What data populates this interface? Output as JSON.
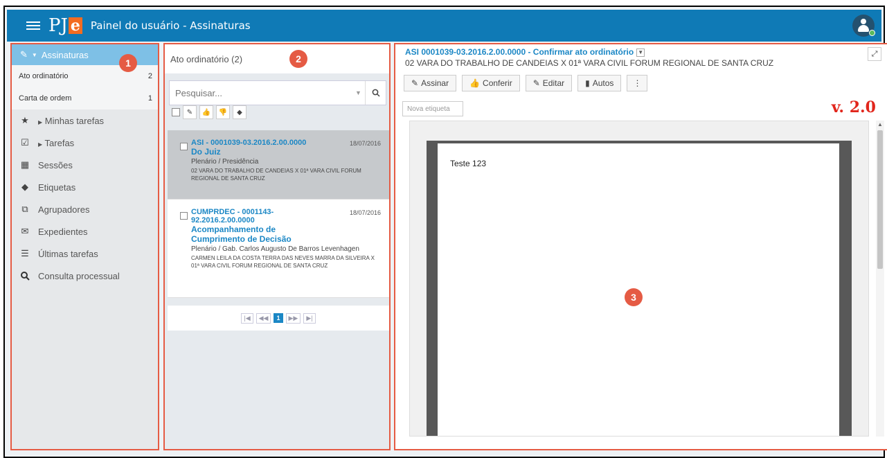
{
  "header": {
    "logo_main": "PJ",
    "logo_accent": "e",
    "title": "Painel do usuário - Assinaturas"
  },
  "sidebar": {
    "section_title": "Assinaturas",
    "sub_items": [
      {
        "label": "Ato ordinatório",
        "count": "2"
      },
      {
        "label": "Carta de ordem",
        "count": "1"
      }
    ],
    "items": [
      {
        "label": "Minhas tarefas"
      },
      {
        "label": "Tarefas"
      },
      {
        "label": "Sessões"
      },
      {
        "label": "Etiquetas"
      },
      {
        "label": "Agrupadores"
      },
      {
        "label": "Expedientes"
      },
      {
        "label": "Últimas tarefas"
      },
      {
        "label": "Consulta processual"
      }
    ]
  },
  "middle": {
    "heading": "Ato ordinatório (2)",
    "search_placeholder": "Pesquisar...",
    "cards": [
      {
        "number": "ASI - 0001039-03.2016.2.00.0000",
        "kind": "Do Juiz",
        "date": "18/07/2016",
        "org": "Plenário / Presidência",
        "parts": "02 VARA DO TRABALHO DE CANDEIAS X 01ª VARA CIVIL FORUM REGIONAL DE SANTA CRUZ"
      },
      {
        "number": "CUMPRDEC - 0001143-92.2016.2.00.0000",
        "kind": "Acompanhamento de Cumprimento de Decisão",
        "date": "18/07/2016",
        "org": "Plenário / Gab. Carlos Augusto De Barros Levenhagen",
        "parts": "CARMEN LEILA DA COSTA TERRA DAS NEVES MARRA DA SILVEIRA X 01ª VARA CIVIL FORUM REGIONAL DE SANTA CRUZ"
      }
    ],
    "pager": {
      "current": "1"
    }
  },
  "detail": {
    "doc_title": "ASI 0001039-03.2016.2.00.0000 - Confirmar ato ordinatório",
    "doc_parts": "02 VARA DO TRABALHO DE CANDEIAS X 01ª VARA CIVIL FORUM REGIONAL DE SANTA CRUZ",
    "actions": {
      "sign": "Assinar",
      "check": "Conferir",
      "edit": "Editar",
      "records": "Autos"
    },
    "tag_placeholder": "Nova etiqueta",
    "page_text": "Teste 123",
    "version": "v. 2.0"
  },
  "badges": {
    "one": "1",
    "two": "2",
    "three": "3"
  },
  "colors": {
    "topbar": "#0f7ab6",
    "accent": "#1b87c5",
    "highlight": "#e55b44",
    "version": "#e1261c"
  }
}
